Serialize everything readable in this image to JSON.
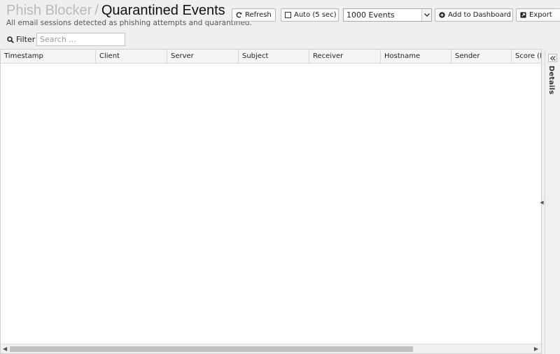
{
  "header": {
    "breadcrumb_app": "Phish Blocker",
    "breadcrumb_sep": "/",
    "title": "Quarantined Events",
    "subtitle": "All email sessions detected as phishing attempts and quarantined."
  },
  "toolbar": {
    "refresh_label": "Refresh",
    "refresh_icon": "refresh-icon",
    "auto_label": "Auto (5 sec)",
    "auto_checked": false,
    "events_selected": "1000 Events",
    "dashboard_label": "Add to Dashboard",
    "dashboard_icon": "plus-circle-icon",
    "export_label": "Export",
    "export_icon": "export-icon"
  },
  "filter": {
    "label": "Filter",
    "placeholder": "Search ..."
  },
  "grid": {
    "columns": [
      "Timestamp",
      "Client",
      "Server",
      "Subject",
      "Receiver",
      "Hostname",
      "Sender",
      "Score (F"
    ],
    "rows": []
  },
  "details": {
    "label": "Details"
  }
}
